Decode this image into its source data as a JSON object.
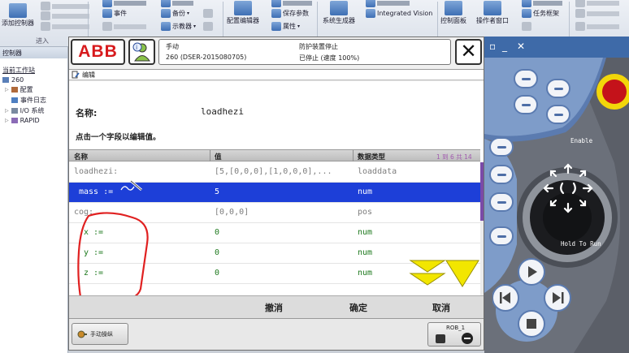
{
  "ribbon": {
    "items": [
      {
        "label": "添加控制器",
        "dim": false
      },
      {
        "label": "事件",
        "dim": false
      },
      {
        "label": "备份",
        "dim": false
      },
      {
        "label": "示教器",
        "dim": false
      },
      {
        "label": "配置编辑器",
        "dim": false
      },
      {
        "label": "保存参数",
        "dim": false
      },
      {
        "label": "属性",
        "dim": false
      },
      {
        "label": "系统生成器",
        "dim": false
      },
      {
        "label": "Integrated Vision",
        "dim": false
      },
      {
        "label": "控制面板",
        "dim": false
      },
      {
        "label": "操作者窗口",
        "dim": false
      },
      {
        "label": "任务框架",
        "dim": false
      }
    ],
    "groups": [
      "进入",
      "传送"
    ]
  },
  "left_panel": {
    "title": "控制器",
    "station": "当前工作站",
    "tree": [
      "260",
      "配置",
      "事件日志",
      "I/O 系统",
      "RAPID"
    ]
  },
  "pendant": {
    "logo": "ABB",
    "status": {
      "mode": "手动",
      "system": "260 (DSER-2015080705)",
      "guard": "防护装置停止",
      "state": "已停止 (速度 100%)"
    },
    "close_glyph": "✕",
    "window_title": "编辑",
    "name_label": "名称:",
    "name_value": "loadhezi",
    "hint": "点击一个字段以编辑值。",
    "columns": {
      "name": "名称",
      "value": "值",
      "type": "数据类型"
    },
    "pager": "1 到 6 共 14",
    "rows": [
      {
        "name": "loadhezi:",
        "value": "[5,[0,0,0],[1,0,0,0],...",
        "type": "loaddata",
        "style": "gray"
      },
      {
        "name": "mass :=",
        "value": "5",
        "type": "num",
        "style": "sel"
      },
      {
        "name": "cog:",
        "value": "[0,0,0]",
        "type": "pos",
        "style": "gray"
      },
      {
        "name": "x :=",
        "value": "0",
        "type": "num",
        "style": "green"
      },
      {
        "name": "y :=",
        "value": "0",
        "type": "num",
        "style": "green"
      },
      {
        "name": "z :=",
        "value": "0",
        "type": "num",
        "style": "green"
      }
    ],
    "buttons": {
      "undo": "撤消",
      "ok": "确定",
      "cancel": "取消"
    },
    "taskbar": {
      "manual": "手动操纵",
      "rob": "ROB_1"
    }
  },
  "hardware": {
    "enable_label": "Enable",
    "hold_label": "Hold To Run"
  },
  "colors": {
    "abb_red": "#d7191c",
    "selection_blue": "#1d3fd8",
    "member_green": "#1e7a1e",
    "annotation_red": "#e02020",
    "scroll_yellow": "#f2e600"
  }
}
